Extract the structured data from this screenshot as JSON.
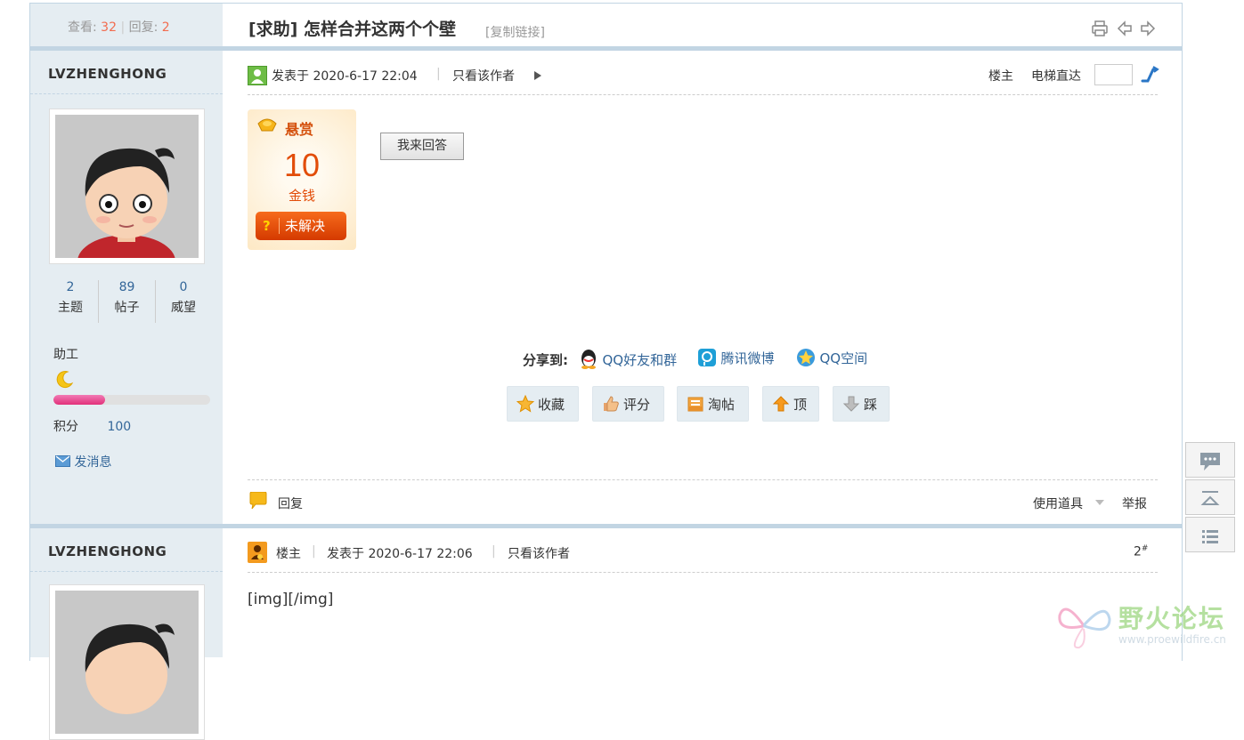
{
  "thread": {
    "views_label": "查看:",
    "views": "32",
    "replies_label": "回复:",
    "replies": "2",
    "tag": "[求助]",
    "title": "怎样合并这两个个壁",
    "copy_link": "[复制链接]"
  },
  "post1": {
    "author": "LVZHENGHONG",
    "stats": [
      {
        "value": "2",
        "label": "主题"
      },
      {
        "value": "89",
        "label": "帖子"
      },
      {
        "value": "0",
        "label": "威望"
      }
    ],
    "rank": "助工",
    "rank_progress": 0.33,
    "points_label": "积分",
    "points": "100",
    "send_message": "发消息",
    "posted_at": "发表于 2020-6-17 22:04",
    "only_author": "只看该作者",
    "floor_label": "楼主",
    "elevator_label": "电梯直达",
    "elevator_value": "",
    "reward": {
      "title": "悬赏",
      "amount": "10",
      "unit": "金钱",
      "status": "未解决"
    },
    "answer_button": "我来回答",
    "share": {
      "label": "分享到:",
      "items": [
        "QQ好友和群",
        "腾讯微博",
        "QQ空间"
      ]
    },
    "actions": [
      "收藏",
      "评分",
      "淘帖",
      "顶",
      "踩"
    ],
    "reply": "回复",
    "use_tools": "使用道具",
    "report": "举报"
  },
  "post2": {
    "author": "LVZHENGHONG",
    "floor_label": "楼主",
    "posted_at": "发表于 2020-6-17 22:06",
    "only_author": "只看该作者",
    "floor_number": "2",
    "floor_sup": "#",
    "content": "[img][/img]"
  },
  "watermark": {
    "name": "野火论坛",
    "url": "www.proewildfire.cn"
  },
  "colors": {
    "accent_blue": "#336699",
    "count_red": "#f26c4f",
    "side_bg": "#e5edf2",
    "border_blue": "#c2d5e3",
    "reward_orange": "#e24d09"
  }
}
